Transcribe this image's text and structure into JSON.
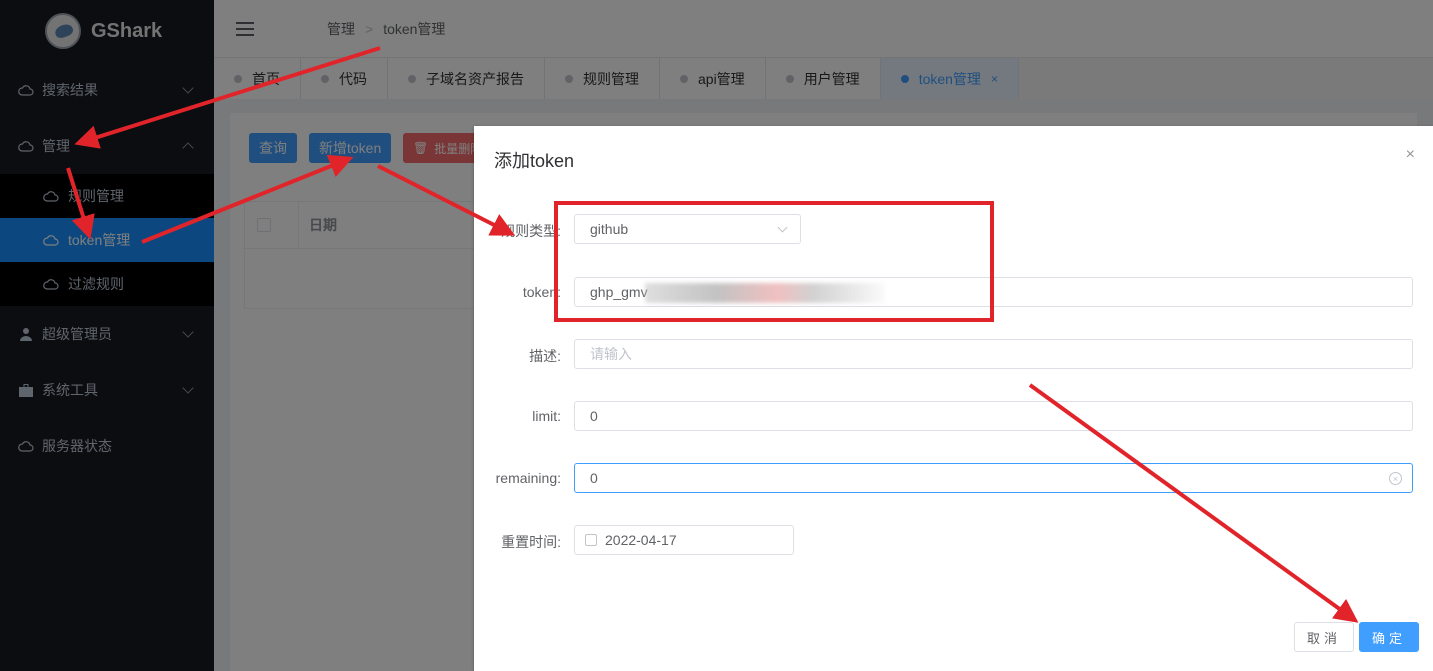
{
  "app": {
    "title": "GShark"
  },
  "sidebar": {
    "items": [
      {
        "label": "搜索结果",
        "icon": "cloud-icon"
      },
      {
        "label": "管理",
        "icon": "cloud-icon"
      },
      {
        "label": "超级管理员",
        "icon": "user-icon"
      },
      {
        "label": "系统工具",
        "icon": "briefcase-icon"
      },
      {
        "label": "服务器状态",
        "icon": "cloud-icon"
      }
    ],
    "submenu": [
      {
        "label": "规则管理"
      },
      {
        "label": "token管理"
      },
      {
        "label": "过滤规则"
      }
    ]
  },
  "header": {
    "breadcrumb": [
      "管理",
      "token管理"
    ]
  },
  "tabs": [
    {
      "label": "首页"
    },
    {
      "label": "代码"
    },
    {
      "label": "子域名资产报告"
    },
    {
      "label": "规则管理"
    },
    {
      "label": "api管理"
    },
    {
      "label": "用户管理"
    },
    {
      "label": "token管理",
      "close": "×"
    }
  ],
  "toolbar": {
    "query": "查询",
    "add": "新增token",
    "batch_delete": "批量删除"
  },
  "table": {
    "columns": [
      "日期"
    ]
  },
  "dialog": {
    "title": "添加token",
    "close": "×",
    "fields": {
      "rule_type": {
        "label": "规则类型:",
        "value": "github"
      },
      "token": {
        "label": "token:",
        "value": "ghp_gmv"
      },
      "desc": {
        "label": "描述:",
        "placeholder": "请输入"
      },
      "limit": {
        "label": "limit:",
        "value": "0"
      },
      "remaining": {
        "label": "remaining:",
        "value": "0"
      },
      "reset_time": {
        "label": "重置时间:",
        "value": "2022-04-17"
      }
    },
    "cancel": "取消",
    "confirm": "确定"
  },
  "colors": {
    "accent": "#409eff",
    "sidebar_bg": "#191a23",
    "annotation": "#e1242a"
  }
}
